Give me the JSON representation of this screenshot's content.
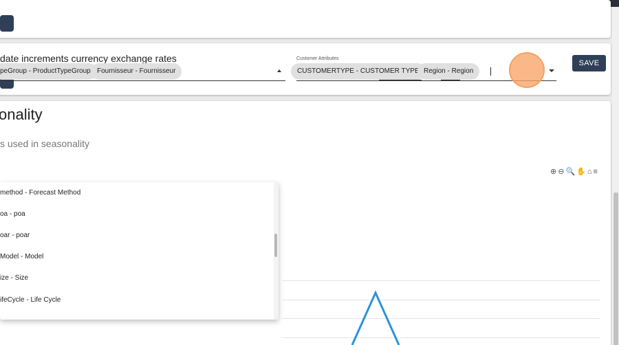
{
  "card2": {
    "text": "date increments currency exchange rates"
  },
  "seasonality": {
    "title": "onality",
    "subtitle": "s used in seasonality"
  },
  "left_select": {
    "chips": [
      "peGroup - ProductTypeGroup",
      "Fournisseur - Fournisseur"
    ]
  },
  "right_select": {
    "label": "Customer Attributes",
    "chips": [
      "CUSTOMERTYPE - CUSTOMER TYPE",
      "Region - Region"
    ]
  },
  "save_button": {
    "label": "SAVE"
  },
  "dropdown": {
    "items": [
      "method - Forecast Method",
      "oa - poa",
      "oar - poar",
      "Model - Model",
      "ize - Size",
      "ifeCycle - Life Cycle"
    ]
  },
  "chart_toolbar": {
    "icons": [
      "zoom-in-icon",
      "zoom-out-icon",
      "zoom-selection-icon",
      "pan-icon",
      "home-icon",
      "menu-icon"
    ]
  },
  "chart_data": {
    "type": "line",
    "series": [
      {
        "values": [
          0,
          1,
          0
        ]
      }
    ],
    "grid": true
  },
  "colors": {
    "primary_button": "#2e3f57",
    "chip": "#e0e0e0",
    "line": "#2b92d8",
    "click_indicator": "#f6a060"
  }
}
